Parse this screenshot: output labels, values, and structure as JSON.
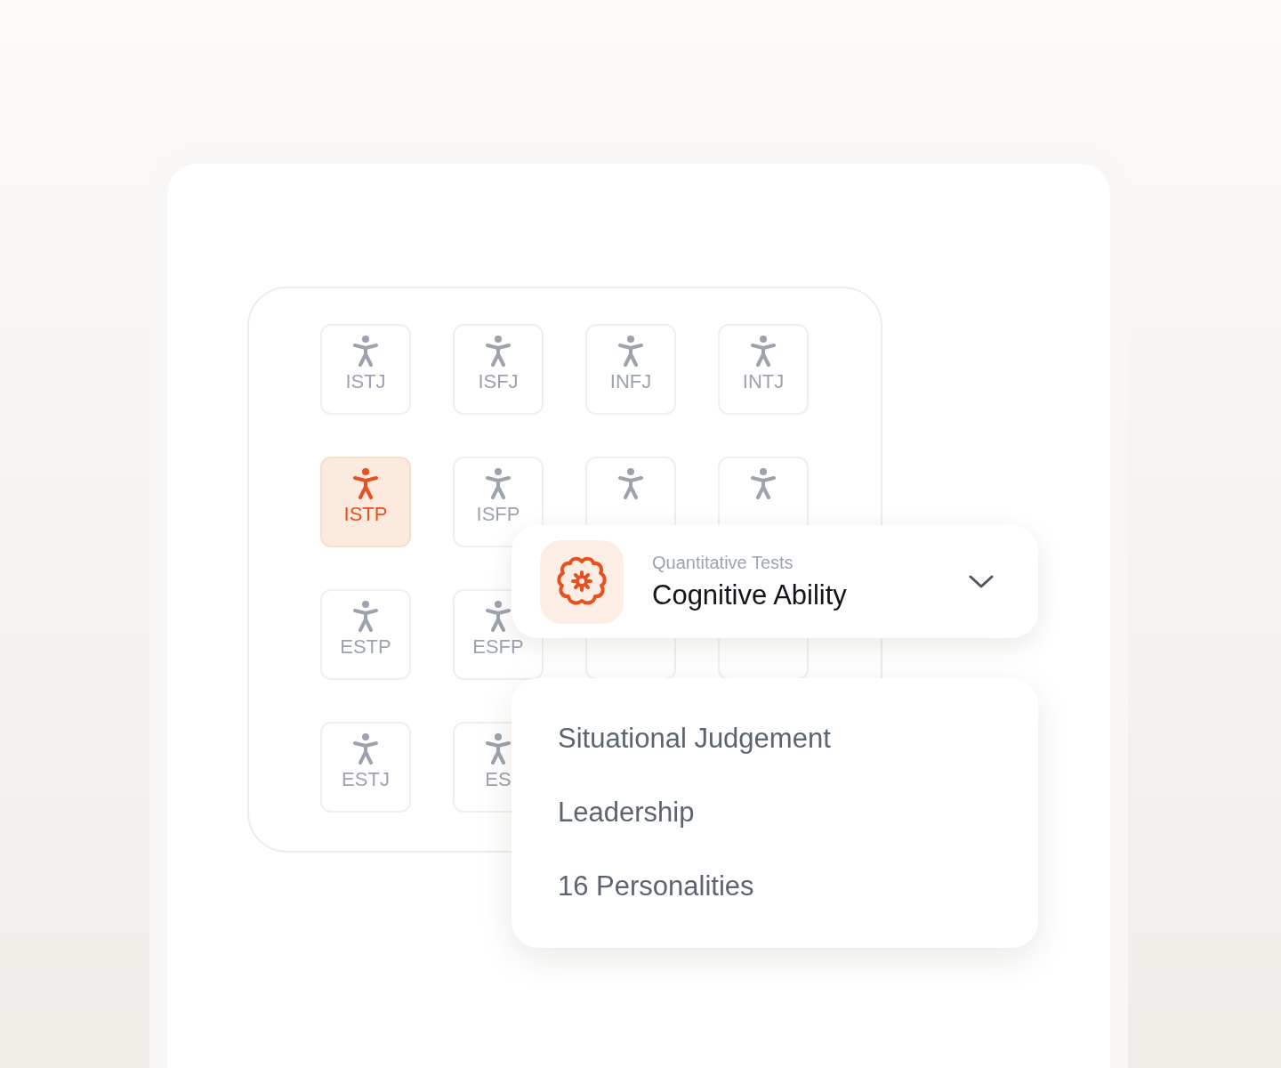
{
  "tiles": [
    {
      "label": "ISTJ",
      "icon": true,
      "selected": false
    },
    {
      "label": "ISFJ",
      "icon": true,
      "selected": false
    },
    {
      "label": "INFJ",
      "icon": true,
      "selected": false
    },
    {
      "label": "INTJ",
      "icon": true,
      "selected": false
    },
    {
      "label": "ISTP",
      "icon": true,
      "selected": true
    },
    {
      "label": "ISFP",
      "icon": true,
      "selected": false
    },
    {
      "icon": true,
      "selected": false
    },
    {
      "icon": true,
      "selected": false
    },
    {
      "label": "ESTP",
      "icon": true,
      "selected": false
    },
    {
      "label": "ESFP",
      "icon": true,
      "selected": false
    },
    {
      "icon": false,
      "selected": false
    },
    {
      "icon": false,
      "selected": false
    },
    {
      "label": "ESTJ",
      "icon": true,
      "selected": false
    },
    {
      "label": "ES",
      "icon": true,
      "selected": false
    }
  ],
  "select": {
    "category": "Quantitative Tests",
    "value": "Cognitive Ability",
    "expanded": true
  },
  "options": [
    "Situational Judgement",
    "Leadership",
    "16 Personalities"
  ]
}
